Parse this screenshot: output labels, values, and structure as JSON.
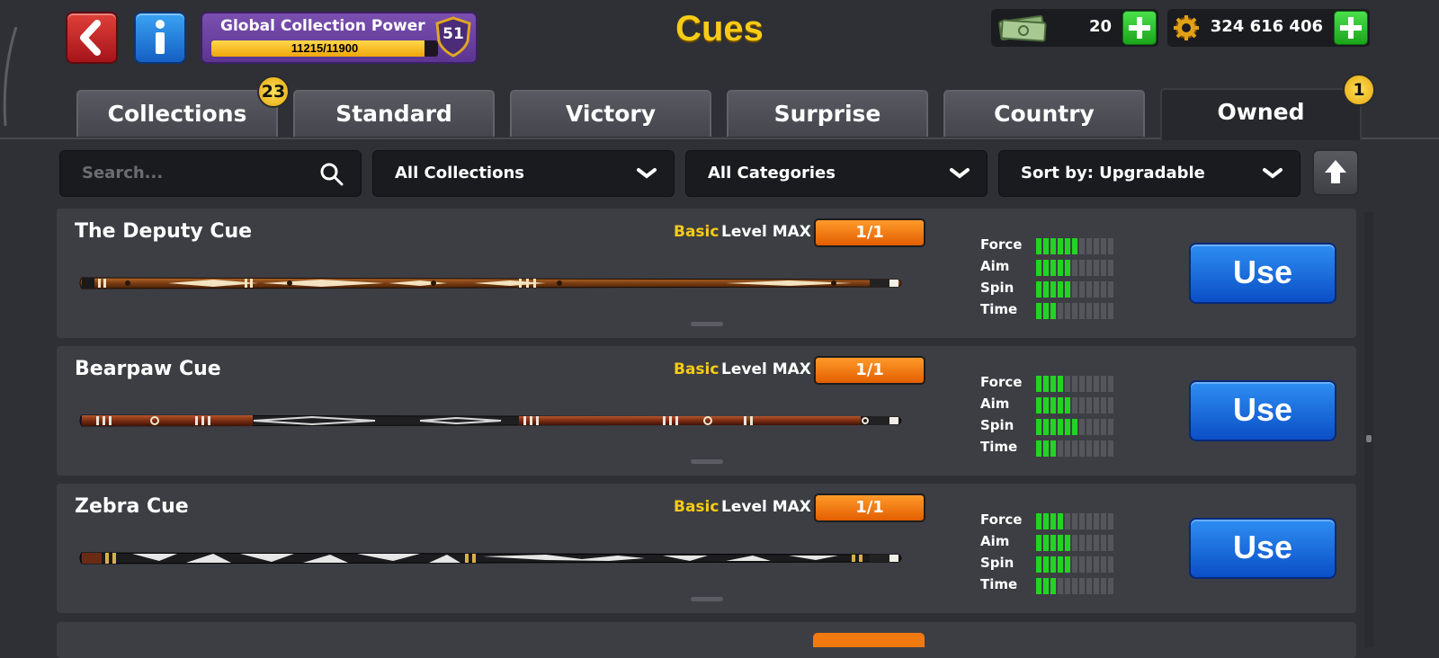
{
  "header": {
    "title": "Cues",
    "power": {
      "label": "Global Collection Power",
      "progress_text": "11215/11900",
      "current": 11215,
      "max": 11900,
      "level": "51"
    },
    "cash": {
      "amount": "20"
    },
    "coins": {
      "amount": "324 616 406"
    }
  },
  "tabs": [
    {
      "label": "Collections",
      "badge": "23",
      "active": false
    },
    {
      "label": "Standard",
      "active": false
    },
    {
      "label": "Victory",
      "active": false
    },
    {
      "label": "Surprise",
      "active": false
    },
    {
      "label": "Country",
      "active": false
    },
    {
      "label": "Owned",
      "badge": "1",
      "active": true
    }
  ],
  "filters": {
    "search_placeholder": "Search...",
    "collections": "All Collections",
    "categories": "All Categories",
    "sort": "Sort by: Upgradable"
  },
  "stat_labels": {
    "force": "Force",
    "aim": "Aim",
    "spin": "Spin",
    "time": "Time"
  },
  "cues": [
    {
      "name": "The Deputy Cue",
      "rarity": "Basic",
      "level": "Level MAX",
      "count": "1/1",
      "stats": {
        "force": 6,
        "aim": 5,
        "spin": 5,
        "time": 3
      },
      "button": "Use"
    },
    {
      "name": "Bearpaw Cue",
      "rarity": "Basic",
      "level": "Level MAX",
      "count": "1/1",
      "stats": {
        "force": 4,
        "aim": 5,
        "spin": 6,
        "time": 3
      },
      "button": "Use"
    },
    {
      "name": "Zebra Cue",
      "rarity": "Basic",
      "level": "Level MAX",
      "count": "1/1",
      "stats": {
        "force": 4,
        "aim": 5,
        "spin": 5,
        "time": 3
      },
      "button": "Use"
    }
  ],
  "stat_max": 11,
  "colors": {
    "title": "#f7cc16",
    "stat_on": "#22d422",
    "stat_off": "#55565c",
    "use_button": "#1f6fe0",
    "count_badge": "#f07a10"
  },
  "icons": [
    "back-arrow-icon",
    "info-icon",
    "shield-level-icon",
    "cash-icon",
    "coin-icon",
    "plus-icon",
    "search-icon",
    "chevron-down-icon",
    "sort-arrow-up-icon"
  ]
}
